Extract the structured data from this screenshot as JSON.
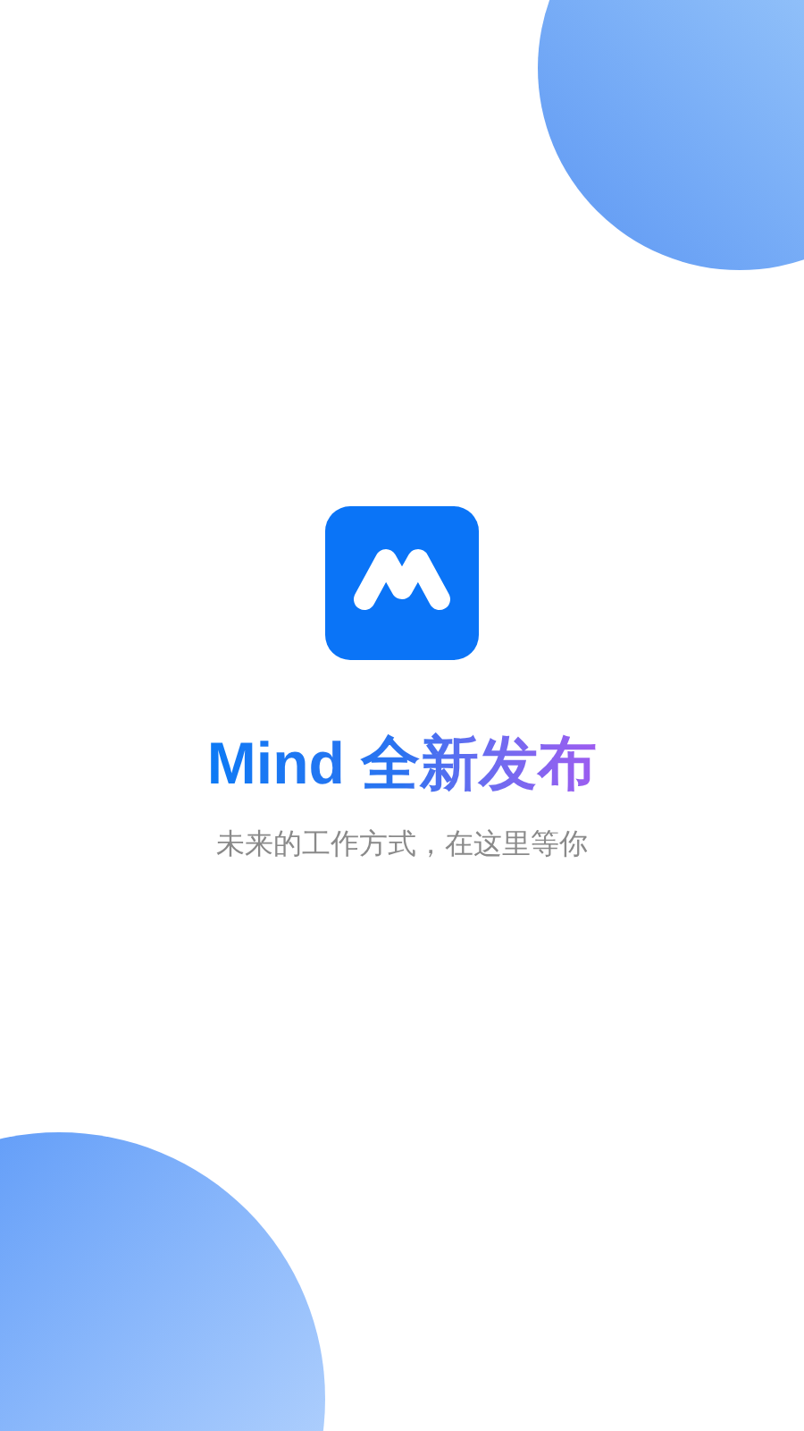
{
  "title": "Mind 全新发布",
  "subtitle": "未来的工作方式，在这里等你"
}
